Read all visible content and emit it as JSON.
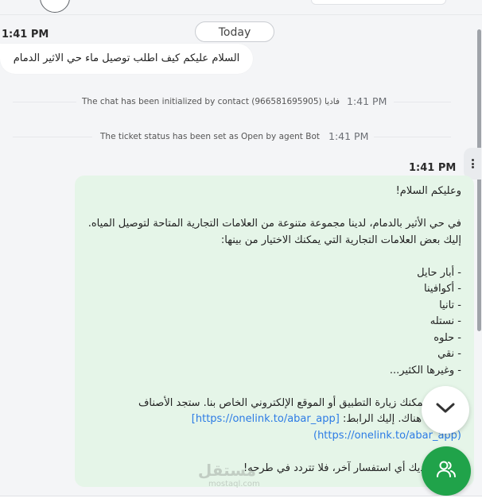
{
  "header": {
    "today_label": "Today"
  },
  "incoming_message": {
    "time": "1:41 PM",
    "text": "السلام عليكم كيف اطلب توصيل ماء حي الاثير الدمام"
  },
  "system_events": [
    {
      "text": "The chat has been initialized by contact (966581695905) فاديا",
      "time": "1:41 PM"
    },
    {
      "text": "The ticket status has been set as Open by agent Bot",
      "time": "1:41 PM"
    }
  ],
  "outgoing_message": {
    "time": "1:41 PM",
    "greeting": "وعليكم السلام!",
    "intro": "في حي الأثير بالدمام، لدينا مجموعة متنوعة من العلامات التجارية المتاحة لتوصيل المياه. إليك بعض العلامات التجارية التي يمكنك الاختيار من بينها:",
    "brands": [
      "- أبار حايل",
      "- أكوافينا",
      "- تانيا",
      "- نستله",
      "- حلوه",
      "- نقي",
      "- وغيرها الكثير..."
    ],
    "order_text_1": "للطلب، يمكنك زيارة التطبيق أو الموقع الإلكتروني الخاص بنا. ستجد الأصناف",
    "order_text_2": "المتوفرة هناك. إليك الرابط:",
    "link_1": "[https://onelink.to/abar_app]",
    "link_2": "(https://onelink.to/abar_app)",
    "closing": "إذا كان لديك أي استفسار آخر، فلا تتردد في طرحه!"
  },
  "watermark": {
    "arabic": "مستقل",
    "latin": "mostaql.com"
  },
  "icons": {
    "scroll_down": "chevron-down-icon",
    "contact": "contacts-icon",
    "menu": "vertical-dots-icon"
  },
  "colors": {
    "outgoing_bubble": "#e5f5e8",
    "contact_fab": "#20a34a",
    "link": "#2c7be5"
  }
}
